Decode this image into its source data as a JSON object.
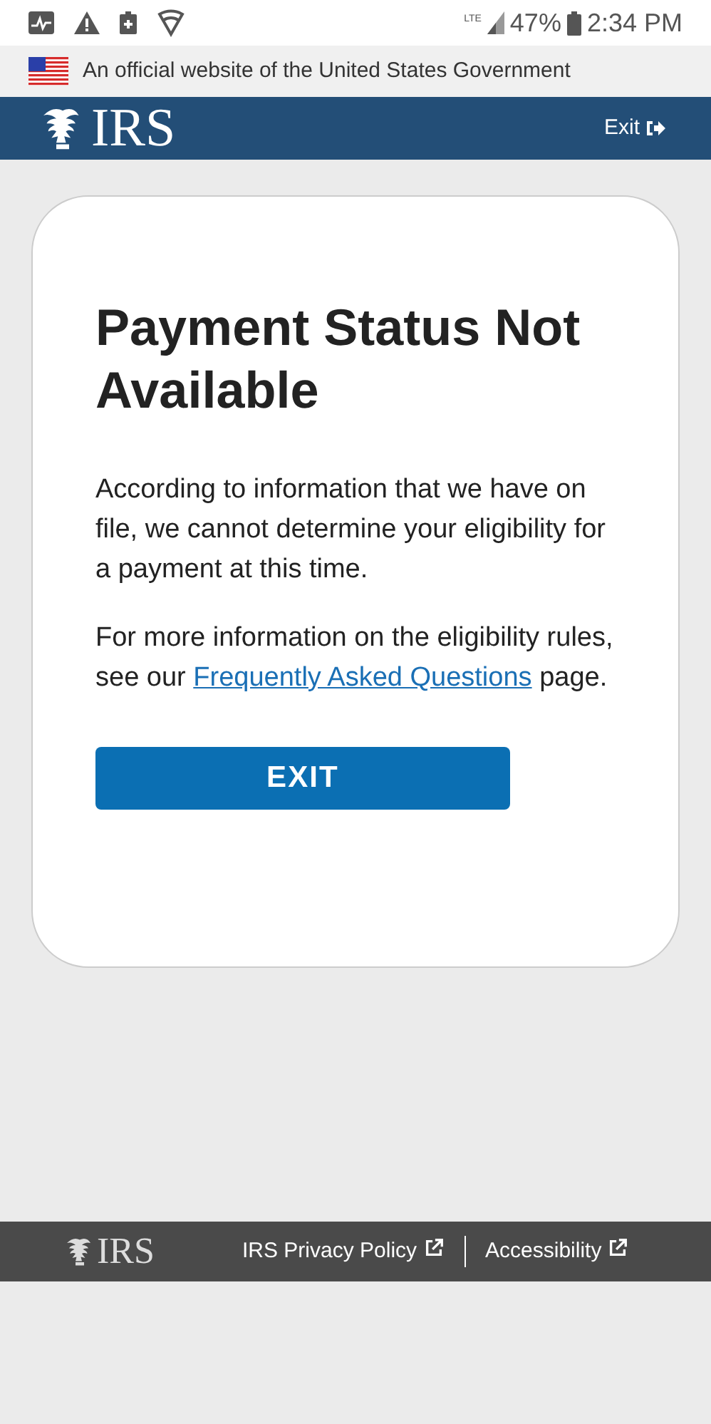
{
  "status_bar": {
    "network": "LTE",
    "battery": "47%",
    "time": "2:34 PM"
  },
  "gov_banner": {
    "text": "An official website of the United States Government"
  },
  "header": {
    "logo": "IRS",
    "exit": "Exit"
  },
  "card": {
    "title": "Payment Status Not Available",
    "paragraph": "According to information that we have on file, we cannot determine your eligibility for a payment at this time.",
    "paragraph_2": {
      "before": "For more information on the eligibility rules, see our ",
      "link": "Frequently Asked Questions",
      "after": " page."
    },
    "button": "EXIT"
  },
  "footer": {
    "logo": "IRS",
    "links": [
      {
        "label": "IRS Privacy Policy"
      },
      {
        "label": "Accessibility"
      }
    ]
  }
}
